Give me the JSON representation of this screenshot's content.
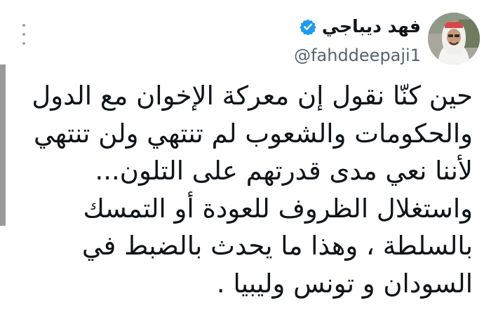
{
  "author": {
    "display_name": "فهد ديباجي",
    "handle": "@fahddeepaji1",
    "verified": true,
    "avatar": "profile-photo"
  },
  "menu": {
    "icon": "more-vertical-icon"
  },
  "tweet": {
    "lines": [
      "حين كنّا نقول إن معركة الإخوان مع الدول",
      "والحكومات والشعوب لم تنتهي ولن تنتهي",
      "لأننا نعي مدى قدرتهم على التلون...",
      "واستغلال الظروف للعودة أو التمسك",
      "بالسلطة ، وهذا ما يحدث بالضبط في",
      "السودان و تونس وليبيا ."
    ]
  },
  "colors": {
    "verified_badge": "#1d9bf0",
    "text_primary": "#0f1419",
    "text_secondary": "#536471"
  }
}
